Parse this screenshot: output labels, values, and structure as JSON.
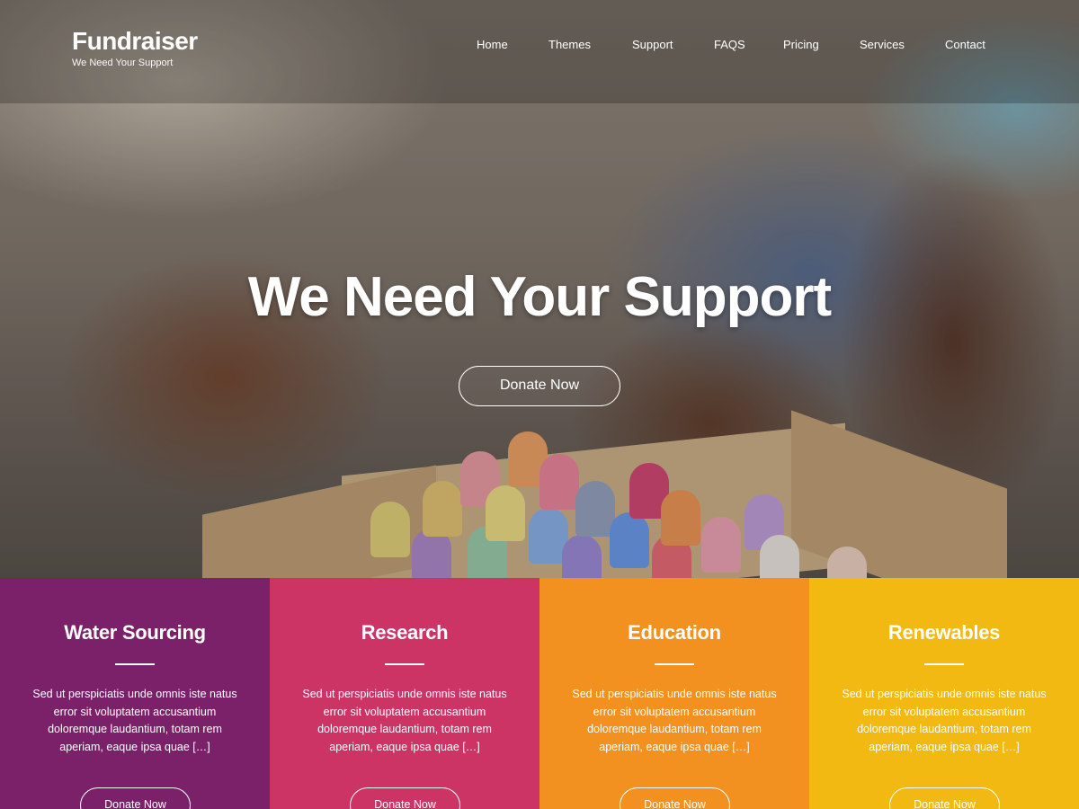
{
  "site": {
    "title": "Fundraiser",
    "tagline": "We Need Your Support"
  },
  "nav": {
    "items": [
      {
        "label": "Home"
      },
      {
        "label": "Themes"
      },
      {
        "label": "Support"
      },
      {
        "label": "FAQS"
      },
      {
        "label": "Pricing"
      },
      {
        "label": "Services"
      },
      {
        "label": "Contact"
      }
    ]
  },
  "hero": {
    "title": "We Need Your Support",
    "button_label": "Donate Now"
  },
  "features": [
    {
      "title": "Water Sourcing",
      "text": "Sed ut perspiciatis unde omnis iste natus error sit voluptatem accusantium doloremque laudantium, totam rem aperiam, eaque ipsa quae […]",
      "button_label": "Donate Now",
      "color": "#7b2169"
    },
    {
      "title": "Research",
      "text": "Sed ut perspiciatis unde omnis iste natus error sit voluptatem accusantium doloremque laudantium, totam rem aperiam, eaque ipsa quae […]",
      "button_label": "Donate Now",
      "color": "#cc3466"
    },
    {
      "title": "Education",
      "text": "Sed ut perspiciatis unde omnis iste natus error sit voluptatem accusantium doloremque laudantium, totam rem aperiam, eaque ipsa quae […]",
      "button_label": "Donate Now",
      "color": "#f39120"
    },
    {
      "title": "Renewables",
      "text": "Sed ut perspiciatis unde omnis iste natus error sit voluptatem accusantium doloremque laudantium, totam rem aperiam, eaque ipsa quae […]",
      "button_label": "Donate Now",
      "color": "#f2b913"
    }
  ]
}
